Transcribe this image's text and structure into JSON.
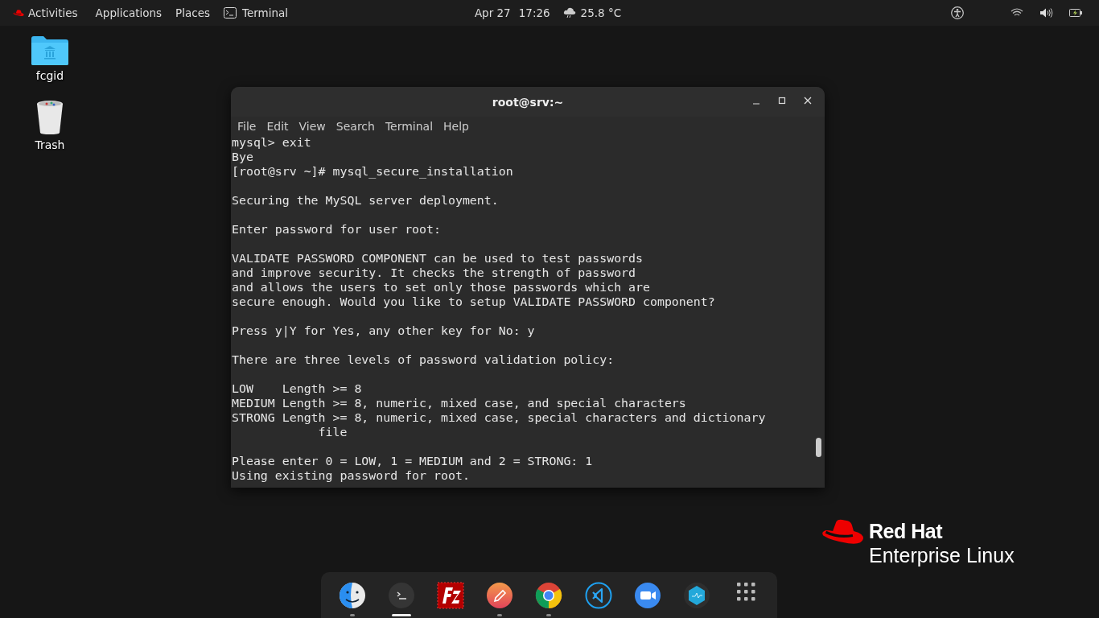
{
  "top_bar": {
    "activities": "Activities",
    "menus": [
      "Applications",
      "Places"
    ],
    "app_name": "Terminal",
    "date": "Apr 27",
    "time": "17:26",
    "weather": "25.8 °C"
  },
  "desktop_icons": [
    {
      "kind": "folder",
      "label": "fcgid"
    },
    {
      "kind": "trash",
      "label": "Trash"
    }
  ],
  "terminal": {
    "title": "root@srv:~",
    "menu": [
      "File",
      "Edit",
      "View",
      "Search",
      "Terminal",
      "Help"
    ],
    "blocks": [
      [
        "mysql> exit",
        "Bye",
        "[root@srv ~]# mysql_secure_installation"
      ],
      [
        "Securing the MySQL server deployment."
      ],
      [
        "Enter password for user root:"
      ],
      [
        "VALIDATE PASSWORD COMPONENT can be used to test passwords",
        "and improve security. It checks the strength of password",
        "and allows the users to set only those passwords which are",
        "secure enough. Would you like to setup VALIDATE PASSWORD component?"
      ],
      [
        "Press y|Y for Yes, any other key for No: y"
      ],
      [
        "There are three levels of password validation policy:"
      ],
      [
        "LOW    Length >= 8",
        "MEDIUM Length >= 8, numeric, mixed case, and special characters",
        "STRONG Length >= 8, numeric, mixed case, special characters and dictionary",
        "            file"
      ],
      [
        "Please enter 0 = LOW, 1 = MEDIUM and 2 = STRONG: 1",
        "Using existing password for root."
      ]
    ]
  },
  "logo": {
    "line_1": "Red Hat",
    "line_2": "Enterprise Linux"
  },
  "dock": [
    {
      "kind": "finder",
      "running": true,
      "selected": false
    },
    {
      "kind": "terminal",
      "running": true,
      "selected": true
    },
    {
      "kind": "filezilla",
      "running": false,
      "selected": false
    },
    {
      "kind": "pencil",
      "running": true,
      "selected": false
    },
    {
      "kind": "chrome",
      "running": true,
      "selected": false
    },
    {
      "kind": "vscode",
      "running": false,
      "selected": false
    },
    {
      "kind": "zoom",
      "running": false,
      "selected": false
    },
    {
      "kind": "hexagon",
      "running": false,
      "selected": false
    },
    {
      "kind": "grid",
      "running": false,
      "selected": false
    }
  ]
}
